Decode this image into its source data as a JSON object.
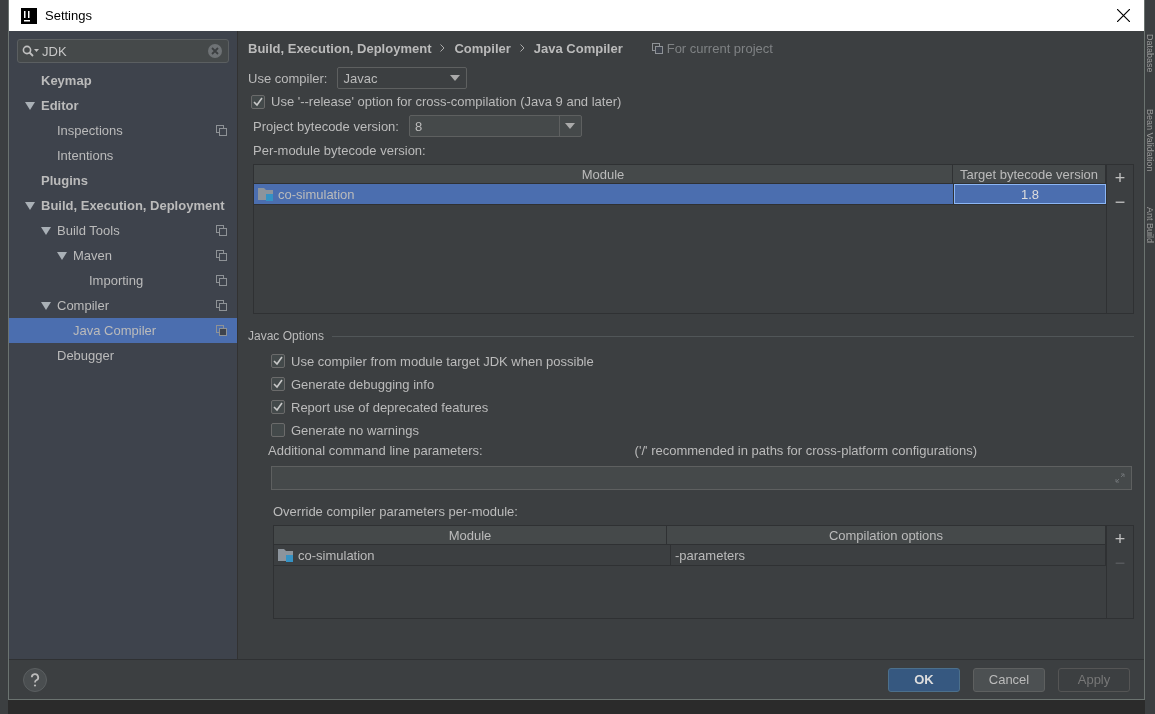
{
  "window": {
    "title": "Settings"
  },
  "search": {
    "value": "JDK"
  },
  "tree": [
    {
      "label": "Keymap",
      "selected": false
    },
    {
      "label": "Editor",
      "selected": false,
      "expanded": true,
      "children": [
        {
          "label": "Inspections",
          "selected": false,
          "project_scoped": true
        },
        {
          "label": "Intentions",
          "selected": false
        }
      ]
    },
    {
      "label": "Plugins",
      "selected": false
    },
    {
      "label": "Build, Execution, Deployment",
      "selected": false,
      "expanded": true,
      "children": [
        {
          "label": "Build Tools",
          "selected": false,
          "expanded": true,
          "project_scoped": true,
          "children": [
            {
              "label": "Maven",
              "selected": false,
              "expanded": true,
              "project_scoped": true,
              "children": [
                {
                  "label": "Importing",
                  "selected": false,
                  "project_scoped": true
                }
              ]
            }
          ]
        },
        {
          "label": "Compiler",
          "selected": false,
          "expanded": true,
          "project_scoped": true,
          "children": [
            {
              "label": "Java Compiler",
              "selected": true,
              "project_scoped": true
            }
          ]
        },
        {
          "label": "Debugger",
          "selected": false
        }
      ]
    }
  ],
  "breadcrumb": [
    "Build, Execution, Deployment",
    "Compiler",
    "Java Compiler"
  ],
  "scope_note": "For current project",
  "use_compiler": {
    "label": "Use compiler:",
    "value": "Javac"
  },
  "release_option": {
    "label": "Use '--release' option for cross-compilation (Java 9 and later)",
    "checked": true
  },
  "project_bytecode": {
    "label": "Project bytecode version:",
    "value": "8"
  },
  "per_module": {
    "label": "Per-module bytecode version:",
    "columns": [
      "Module",
      "Target bytecode version"
    ],
    "rows": [
      {
        "module": "co-simulation",
        "target": "1.8",
        "selected": true
      }
    ],
    "toolbar": [
      {
        "symbol": "+",
        "disabled": false
      },
      {
        "symbol": "−",
        "disabled": false
      }
    ]
  },
  "javac_options": {
    "title": "Javac Options",
    "options": [
      {
        "label": "Use compiler from module target JDK when possible",
        "checked": true
      },
      {
        "label": "Generate debugging info",
        "checked": true
      },
      {
        "label": "Report use of deprecated features",
        "checked": true
      },
      {
        "label": "Generate no warnings",
        "checked": false
      }
    ],
    "additional_label": "Additional command line parameters:",
    "additional_hint": "('/' recommended in paths for cross-platform configurations)",
    "override": {
      "label": "Override compiler parameters per-module:",
      "columns": [
        "Module",
        "Compilation options"
      ],
      "rows": [
        {
          "module": "co-simulation",
          "options": "-parameters",
          "selected": false
        }
      ],
      "toolbar": [
        {
          "symbol": "+",
          "disabled": false
        },
        {
          "symbol": "−",
          "disabled": true
        }
      ]
    }
  },
  "buttons": [
    {
      "label": "OK",
      "kind": "default",
      "disabled": false
    },
    {
      "label": "Cancel",
      "kind": "normal",
      "disabled": false
    },
    {
      "label": "Apply",
      "kind": "normal",
      "disabled": true
    }
  ],
  "side_tabs": [
    "Database",
    "Bean Validation",
    "Ant Build"
  ]
}
